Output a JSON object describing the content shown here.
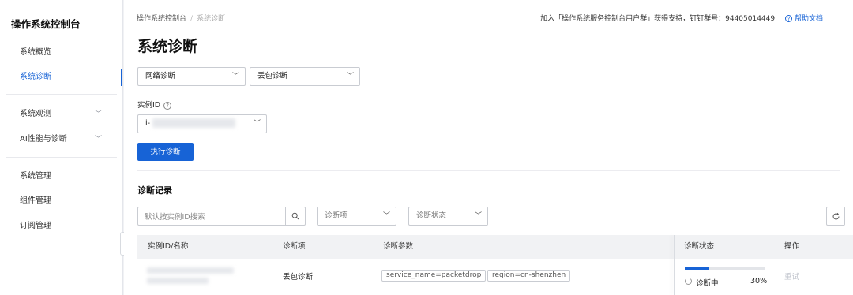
{
  "sidebar": {
    "title": "操作系统控制台",
    "items": [
      {
        "label": "系统概览"
      },
      {
        "label": "系统诊断"
      },
      {
        "label": "系统观测"
      },
      {
        "label": "AI性能与诊断"
      },
      {
        "label": "系统管理"
      },
      {
        "label": "组件管理"
      },
      {
        "label": "订阅管理"
      }
    ],
    "active_item": "系统诊断"
  },
  "header": {
    "breadcrumb": [
      "操作系统控制台",
      "系统诊断"
    ],
    "support_text": "加入「操作系统服务控制台用户群」获得支持，钉钉群号：94405014449",
    "help_label": "帮助文档"
  },
  "page": {
    "title": "系统诊断",
    "diag_category": "网络诊断",
    "diag_type": "丢包诊断",
    "instance_label": "实例ID",
    "instance_value": "i-",
    "run_button": "执行诊断"
  },
  "records": {
    "title": "诊断记录",
    "search_placeholder": "默认按实例ID搜索",
    "filter_item": "诊断项",
    "filter_status": "诊断状态",
    "columns": [
      "实例ID/名称",
      "诊断项",
      "诊断参数",
      "诊断状态",
      "操作"
    ],
    "rows": [
      {
        "item": "丢包诊断",
        "params": [
          "service_name=packetdrop",
          "region=cn-shenzhen"
        ],
        "status": "诊断中",
        "progress_percent": 30,
        "progress_label": "30%",
        "action": "重试"
      }
    ]
  },
  "colors": {
    "accent": "#1763d6",
    "disabled_text": "#c0c4cc"
  }
}
